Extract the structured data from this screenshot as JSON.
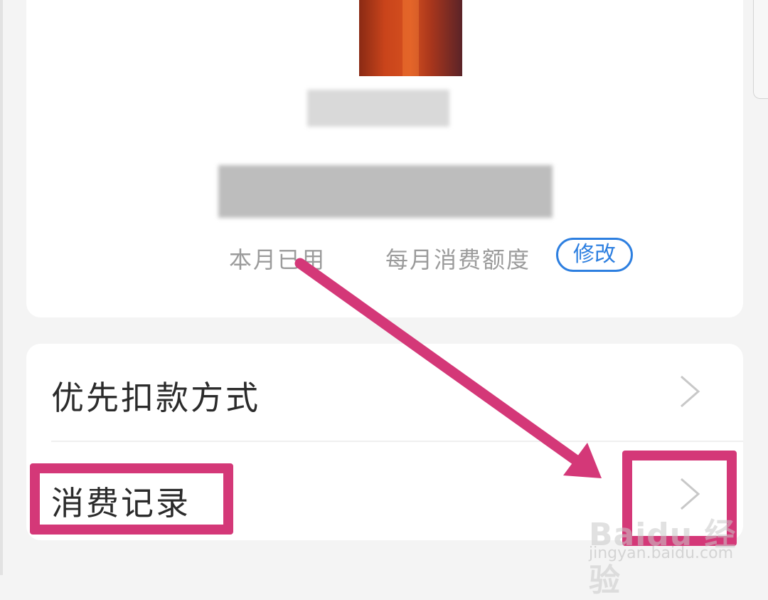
{
  "balance_card": {
    "used_label": "本月已用",
    "quota_label": "每月消费额度",
    "modify_button": "修改"
  },
  "menu": {
    "items": [
      {
        "label": "优先扣款方式",
        "icon": "chevron-right-icon"
      },
      {
        "label": "消费记录",
        "icon": "chevron-right-icon"
      }
    ]
  },
  "annotation": {
    "color": "#d43878"
  },
  "watermark": {
    "logo": "Baidu 经验",
    "url": "jingyan.baidu.com"
  }
}
